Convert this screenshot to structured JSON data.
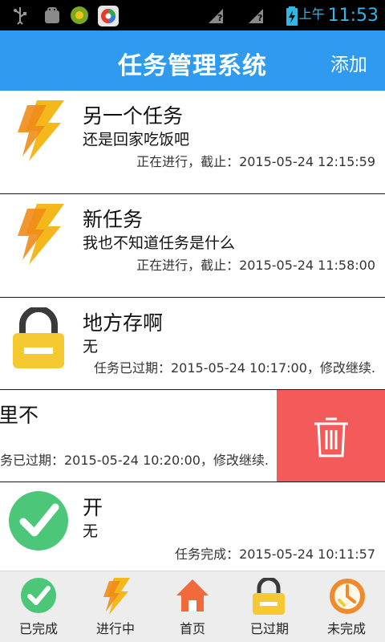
{
  "status_bar": {
    "ampm": "上午",
    "time": "11:53",
    "icons": [
      "usb-icon",
      "android-debug-icon",
      "app-notification-icon",
      "app-store-icon",
      "signal-unknown-icon",
      "signal-unknown-icon",
      "battery-charging-icon"
    ]
  },
  "header": {
    "title": "任务管理系统",
    "add_label": "添加",
    "color": "#2f9bf0"
  },
  "tasks": [
    {
      "title": "另一个任务",
      "desc": "还是回家吃饭吧",
      "status": "正在进行，截止：2015-05-24 12:15:59",
      "icon": "lightning-icon"
    },
    {
      "title": "新任务",
      "desc": "我也不知道任务是什么",
      "status": "正在进行，截止：2015-05-24 11:58:00",
      "icon": "lightning-icon"
    },
    {
      "title": "地方存啊",
      "desc": "无",
      "status": "任务已过期：2015-05-24 10:17:00，修改继续.",
      "icon": "lock-icon"
    },
    {
      "title": "里不",
      "status": "务已过期：2015-05-24 10:20:00，修改继续.",
      "icon": "trash-icon",
      "swiped": true
    },
    {
      "title": "开",
      "desc": "无",
      "status": "任务完成：2015-05-24 10:11:57",
      "icon": "check-icon"
    }
  ],
  "tabs": [
    {
      "label": "已完成",
      "icon": "check-icon"
    },
    {
      "label": "进行中",
      "icon": "lightning-icon"
    },
    {
      "label": "首页",
      "icon": "home-icon"
    },
    {
      "label": "已过期",
      "icon": "lock-icon"
    },
    {
      "label": "未完成",
      "icon": "clock-icon"
    }
  ],
  "colors": {
    "accent": "#2f9bf0",
    "delete": "#f55a5a",
    "lightning": "#f5b81c",
    "lock": "#f5c932",
    "check": "#4cc77a",
    "home": "#f06a3c",
    "clock": "#f08a2c"
  }
}
